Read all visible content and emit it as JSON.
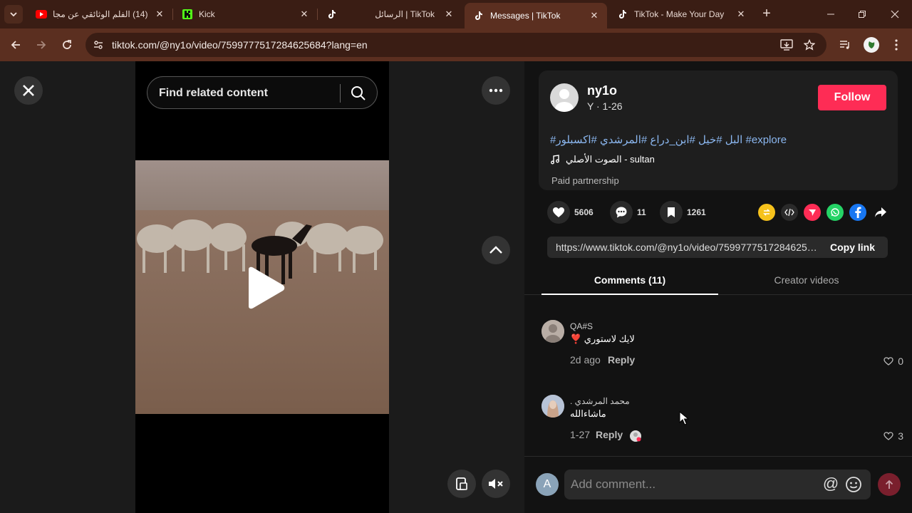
{
  "browser": {
    "tabs": [
      {
        "title": "(14) الفلم الوثائقي عن مجا",
        "icon": "youtube-icon"
      },
      {
        "title": "Kick",
        "icon": "kick-icon"
      },
      {
        "title": "TikTok | الرسائل",
        "icon": "tiktok-icon"
      },
      {
        "title": "Messages | TikTok",
        "icon": "tiktok-icon",
        "active": true
      },
      {
        "title": "TikTok - Make Your Day",
        "icon": "tiktok-icon"
      }
    ],
    "close_glyph": "✕",
    "new_tab_glyph": "+",
    "url": "tiktok.com/@ny1o/video/7599777517284625684?lang=en"
  },
  "player": {
    "search_placeholder": "Find related content"
  },
  "post": {
    "author": "ny1o",
    "meta": "Y · 1-26",
    "follow_label": "Follow",
    "caption": "#البل #خيل #ابن_دراع #المرشدي #اكسبلور #explore",
    "music": "الصوت الأصلي - sultan",
    "paid_label": "Paid partnership",
    "likes": "5606",
    "comments": "11",
    "saves": "1261",
    "link": "https://www.tiktok.com/@ny1o/video/7599777517284625684",
    "copy_label": "Copy link"
  },
  "tabs": {
    "comments": "Comments (11)",
    "creator": "Creator videos"
  },
  "comments": [
    {
      "user": "QA#S",
      "text": "لايك لاستوري ❣️",
      "date": "2d ago",
      "reply": "Reply",
      "likes": "0"
    },
    {
      "user": "محمد المرشدي .",
      "text": "ماشاءالله",
      "date": "1-27",
      "reply": "Reply",
      "likes": "3"
    }
  ],
  "composer": {
    "avatar_letter": "A",
    "placeholder": "Add comment..."
  },
  "colors": {
    "accent": "#fe2c55",
    "hashtag": "#8bb7f0"
  }
}
